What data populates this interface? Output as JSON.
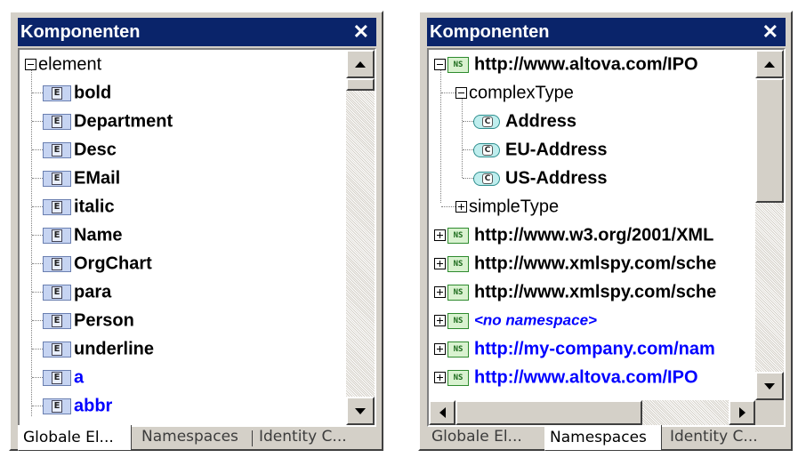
{
  "left_panel": {
    "title": "Komponenten",
    "close_label": "✕",
    "root": {
      "label": "element"
    },
    "items": [
      {
        "label": "bold"
      },
      {
        "label": "Department"
      },
      {
        "label": "Desc"
      },
      {
        "label": "EMail"
      },
      {
        "label": "italic"
      },
      {
        "label": "Name"
      },
      {
        "label": "OrgChart"
      },
      {
        "label": "para"
      },
      {
        "label": "Person"
      },
      {
        "label": "underline"
      },
      {
        "label": "a"
      },
      {
        "label": "abbr"
      }
    ],
    "element_icon_letter": "E",
    "tabs": [
      {
        "label": "Globale El...",
        "active": true
      },
      {
        "label": "Namespaces",
        "active": false
      },
      {
        "label": "Identity C...",
        "active": false
      }
    ]
  },
  "right_panel": {
    "title": "Komponenten",
    "close_label": "✕",
    "ns_icon_text": "NS",
    "complex_icon_letter": "C",
    "root_namespace": "http://www.altova.com/IPO",
    "complex_type_label": "complexType",
    "complex_types": [
      {
        "label": "Address"
      },
      {
        "label": "EU-Address"
      },
      {
        "label": "US-Address"
      }
    ],
    "simple_type_label": "simpleType",
    "namespaces": [
      {
        "label": "http://www.w3.org/2001/XML",
        "style": "normal"
      },
      {
        "label": "http://www.xmlspy.com/sche",
        "style": "normal"
      },
      {
        "label": "http://www.xmlspy.com/sche",
        "style": "normal"
      },
      {
        "label": "<no namespace>",
        "style": "italic-blue"
      },
      {
        "label": "http://my-company.com/nam",
        "style": "blue"
      },
      {
        "label": "http://www.altova.com/IPO",
        "style": "blue"
      }
    ],
    "tabs": [
      {
        "label": "Globale El...",
        "active": false
      },
      {
        "label": "Namespaces",
        "active": true
      },
      {
        "label": "Identity C...",
        "active": false
      }
    ]
  },
  "colors": {
    "title_bar": "#0a246a",
    "panel_face": "#d4d0c8",
    "link_blue": "#0000ff"
  }
}
